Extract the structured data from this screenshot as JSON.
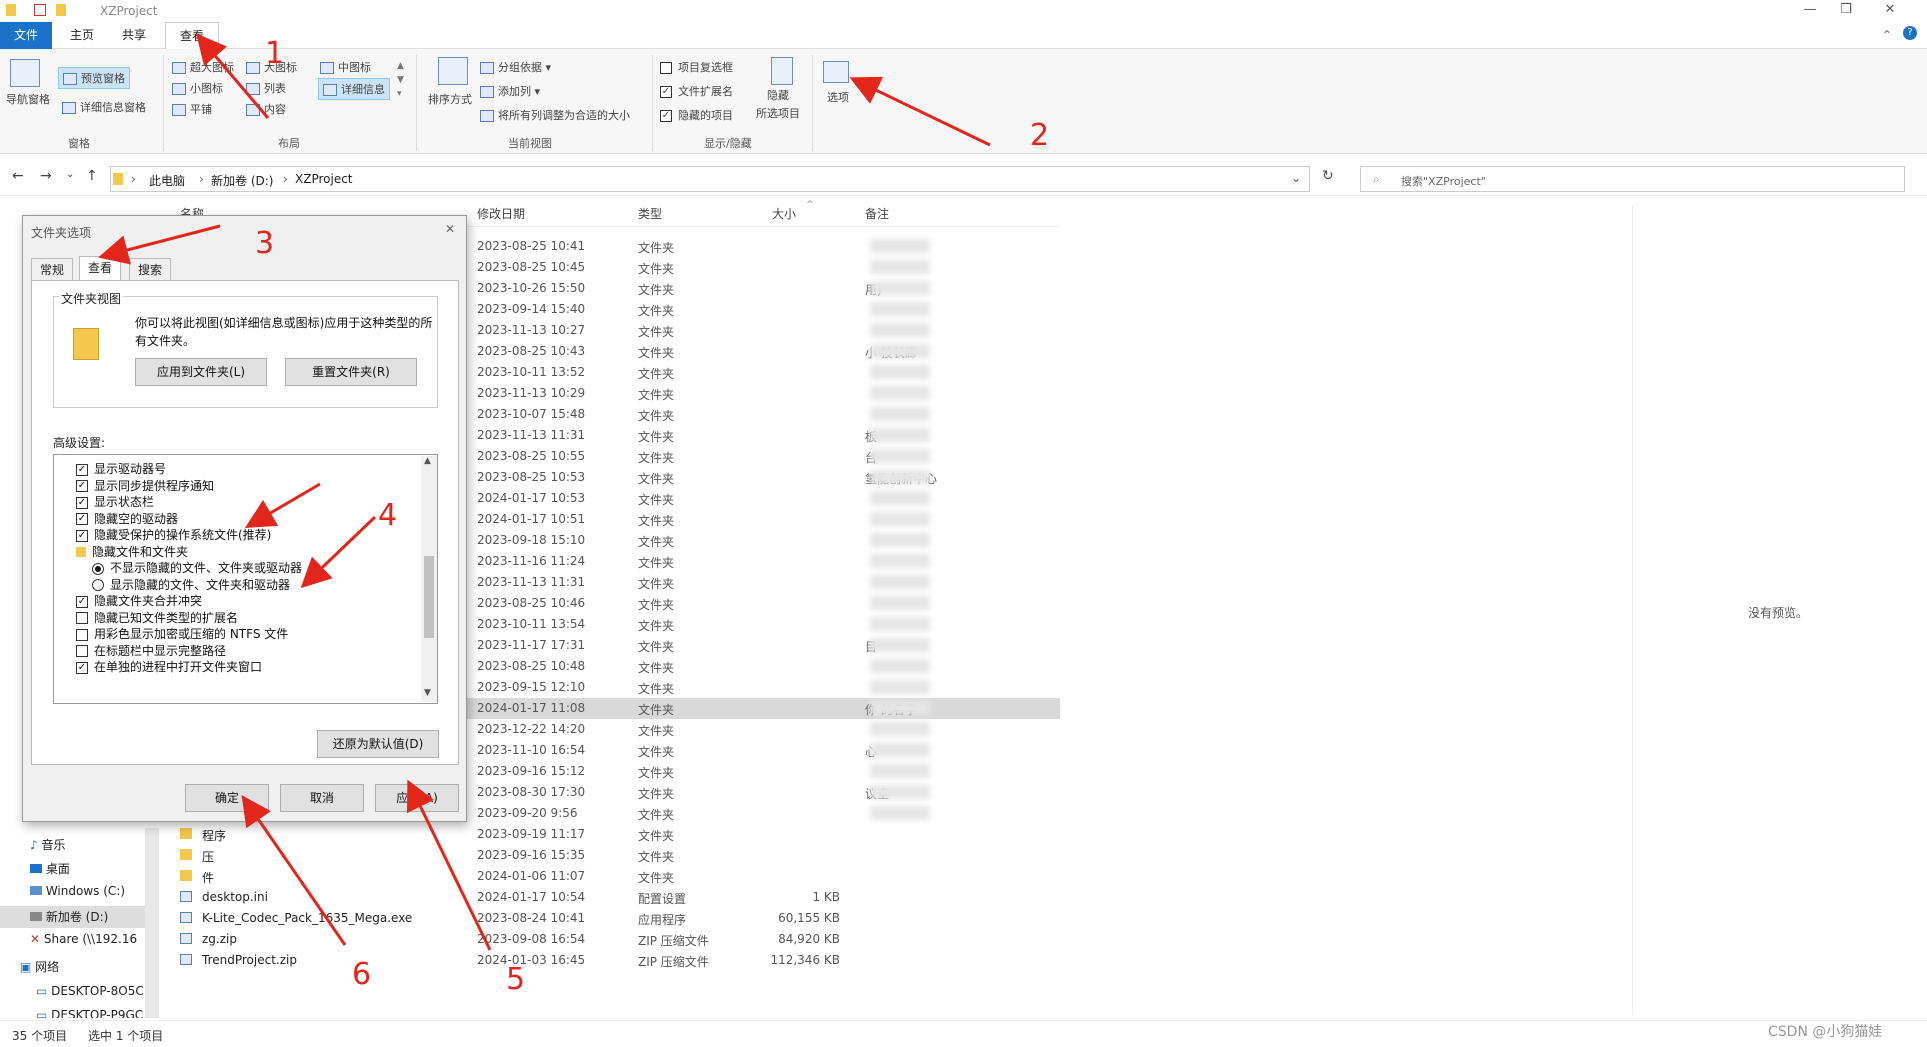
{
  "window": {
    "title": "XZProject",
    "minimize": "—",
    "restore": "❐",
    "close": "✕"
  },
  "ribbon_tabs": [
    "文件",
    "主页",
    "共享",
    "查看"
  ],
  "ribbon": {
    "panes": {
      "nav_pane": "导航窗格",
      "preview_pane": "预览窗格",
      "details_pane": "详细信息窗格",
      "group": "窗格"
    },
    "layout": {
      "items": [
        "超大图标",
        "大图标",
        "中图标",
        "小图标",
        "列表",
        "详细信息",
        "平铺",
        "内容"
      ],
      "group": "布局"
    },
    "current_view": {
      "sort": "排序方式",
      "group_by": "分组依据",
      "add_column": "添加列",
      "fit_columns": "将所有列调整为合适的大小",
      "group": "当前视图"
    },
    "show_hide": {
      "item_checkboxes": "项目复选框",
      "file_extensions": "文件扩展名",
      "hidden_items": "隐藏的项目",
      "hide_selected_line1": "隐藏",
      "hide_selected_line2": "所选项目",
      "group": "显示/隐藏"
    },
    "options": "选项"
  },
  "address": {
    "breadcrumb": [
      "此电脑",
      "新加卷 (D:)",
      "XZProject"
    ],
    "search_placeholder": "搜索\"XZProject\""
  },
  "columns": {
    "name": "名称",
    "modified": "修改日期",
    "type": "类型",
    "size": "大小",
    "notes": "备注"
  },
  "rows": [
    {
      "date": "2023-08-25 10:41",
      "type": "文件夹",
      "size": "",
      "name": "",
      "note": ""
    },
    {
      "date": "2023-08-25 10:45",
      "type": "文件夹",
      "size": "",
      "name": "",
      "note": ""
    },
    {
      "date": "2023-10-26 15:50",
      "type": "文件夹",
      "size": "",
      "name": "",
      "note": "用)"
    },
    {
      "date": "2023-09-14 15:40",
      "type": "文件夹",
      "size": "",
      "name": "",
      "note": ""
    },
    {
      "date": "2023-11-13 10:27",
      "type": "文件夹",
      "size": "",
      "name": "",
      "note": ""
    },
    {
      "date": "2023-08-25 10:43",
      "type": "文件夹",
      "size": "",
      "name": "",
      "note": "小 技长廊"
    },
    {
      "date": "2023-10-11 13:52",
      "type": "文件夹",
      "size": "",
      "name": "",
      "note": ""
    },
    {
      "date": "2023-11-13 10:29",
      "type": "文件夹",
      "size": "",
      "name": "",
      "note": ""
    },
    {
      "date": "2023-10-07 15:48",
      "type": "文件夹",
      "size": "",
      "name": "",
      "note": ""
    },
    {
      "date": "2023-11-13 11:31",
      "type": "文件夹",
      "size": "",
      "name": "",
      "note": "板"
    },
    {
      "date": "2023-08-25 10:55",
      "type": "文件夹",
      "size": "",
      "name": "",
      "note": "台"
    },
    {
      "date": "2023-08-25 10:53",
      "type": "文件夹",
      "size": "",
      "name": "",
      "note": "氢能创新中心"
    },
    {
      "date": "2024-01-17 10:53",
      "type": "文件夹",
      "size": "",
      "name": "",
      "note": ""
    },
    {
      "date": "2024-01-17 10:51",
      "type": "文件夹",
      "size": "",
      "name": "",
      "note": ""
    },
    {
      "date": "2023-09-18 15:10",
      "type": "文件夹",
      "size": "",
      "name": "",
      "note": ""
    },
    {
      "date": "2023-11-16 11:24",
      "type": "文件夹",
      "size": "",
      "name": "",
      "note": ""
    },
    {
      "date": "2023-11-13 11:31",
      "type": "文件夹",
      "size": "",
      "name": "",
      "note": ""
    },
    {
      "date": "2023-08-25 10:46",
      "type": "文件夹",
      "size": "",
      "name": "",
      "note": ""
    },
    {
      "date": "2023-10-11 13:54",
      "type": "文件夹",
      "size": "",
      "name": "",
      "note": ""
    },
    {
      "date": "2023-11-17 17:31",
      "type": "文件夹",
      "size": "",
      "name": "",
      "note": "目"
    },
    {
      "date": "2023-08-25 10:48",
      "type": "文件夹",
      "size": "",
      "name": "",
      "note": ""
    },
    {
      "date": "2023-09-15 12:10",
      "type": "文件夹",
      "size": "",
      "name": "",
      "note": ""
    },
    {
      "date": "2024-01-17 11:08",
      "type": "文件夹",
      "size": "",
      "name": "",
      "note": "你 的名字",
      "selected": true
    },
    {
      "date": "2023-12-22 14:20",
      "type": "文件夹",
      "size": "",
      "name": "",
      "note": ""
    },
    {
      "date": "2023-11-10 16:54",
      "type": "文件夹",
      "size": "",
      "name": "",
      "note": "心"
    },
    {
      "date": "2023-09-16 15:12",
      "type": "文件夹",
      "size": "",
      "name": "",
      "note": ""
    },
    {
      "date": "2023-08-30 17:30",
      "type": "文件夹",
      "size": "",
      "name": "",
      "note": "议室"
    },
    {
      "date": "2023-09-20 9:56",
      "type": "文件夹",
      "size": "",
      "name": "",
      "note": ""
    },
    {
      "date": "2023-09-19 11:17",
      "type": "文件夹",
      "size": "",
      "name": "程序",
      "note": ""
    },
    {
      "date": "2023-09-16 15:35",
      "type": "文件夹",
      "size": "",
      "name": "压",
      "note": ""
    },
    {
      "date": "2024-01-06 11:07",
      "type": "文件夹",
      "size": "",
      "name": "件",
      "note": ""
    },
    {
      "date": "2024-01-17 10:54",
      "type": "配置设置",
      "size": "1 KB",
      "name": "desktop.ini",
      "note": ""
    },
    {
      "date": "2023-08-24 10:41",
      "type": "应用程序",
      "size": "60,155 KB",
      "name": "K-Lite_Codec_Pack_1635_Mega.exe",
      "note": ""
    },
    {
      "date": "2023-09-08 16:54",
      "type": "ZIP 压缩文件",
      "size": "84,920 KB",
      "name": "zg.zip",
      "note": ""
    },
    {
      "date": "2024-01-03 16:45",
      "type": "ZIP 压缩文件",
      "size": "112,346 KB",
      "name": "TrendProject.zip",
      "note": ""
    }
  ],
  "preview_text": "没有预览。",
  "nav_items": [
    "音乐",
    "桌面",
    "Windows (C:)",
    "新加卷 (D:)",
    "Share (\\\\192.16",
    "网络",
    "DESKTOP-8O5C",
    "DESKTOP-P9GC"
  ],
  "status": {
    "count": "35 个项目",
    "selected": "选中 1 个项目"
  },
  "dialog": {
    "title": "文件夹选项",
    "close": "✕",
    "tabs": [
      "常规",
      "查看",
      "搜索"
    ],
    "folder_views_label": "文件夹视图",
    "folder_views_text": "你可以将此视图(如详细信息或图标)应用于这种类型的所有文件夹。",
    "apply_to_folders": "应用到文件夹(L)",
    "reset_folders": "重置文件夹(R)",
    "advanced_label": "高级设置:",
    "settings": [
      {
        "kind": "check",
        "checked": true,
        "label": "显示驱动器号"
      },
      {
        "kind": "check",
        "checked": true,
        "label": "显示同步提供程序通知"
      },
      {
        "kind": "check",
        "checked": true,
        "label": "显示状态栏"
      },
      {
        "kind": "check",
        "checked": true,
        "label": "隐藏空的驱动器"
      },
      {
        "kind": "check",
        "checked": true,
        "label": "隐藏受保护的操作系统文件(推荐)"
      },
      {
        "kind": "folder",
        "checked": false,
        "label": "隐藏文件和文件夹"
      },
      {
        "kind": "radio",
        "checked": true,
        "label": "不显示隐藏的文件、文件夹或驱动器"
      },
      {
        "kind": "radio",
        "checked": false,
        "label": "显示隐藏的文件、文件夹和驱动器"
      },
      {
        "kind": "check",
        "checked": true,
        "label": "隐藏文件夹合并冲突"
      },
      {
        "kind": "check",
        "checked": false,
        "label": "隐藏已知文件类型的扩展名"
      },
      {
        "kind": "check",
        "checked": false,
        "label": "用彩色显示加密或压缩的 NTFS 文件"
      },
      {
        "kind": "check",
        "checked": false,
        "label": "在标题栏中显示完整路径"
      },
      {
        "kind": "check",
        "checked": true,
        "label": "在单独的进程中打开文件夹窗口"
      }
    ],
    "restore_defaults": "还原为默认值(D)",
    "ok": "确定",
    "cancel": "取消",
    "apply": "应用(A)"
  },
  "annotations": [
    "1",
    "2",
    "3",
    "4",
    "5",
    "6"
  ],
  "watermark": "CSDN @小狗猫娃",
  "colors": {
    "accent": "#1a73c8",
    "annotation": "#e3261c",
    "selected_row": "#d9d9d9"
  }
}
